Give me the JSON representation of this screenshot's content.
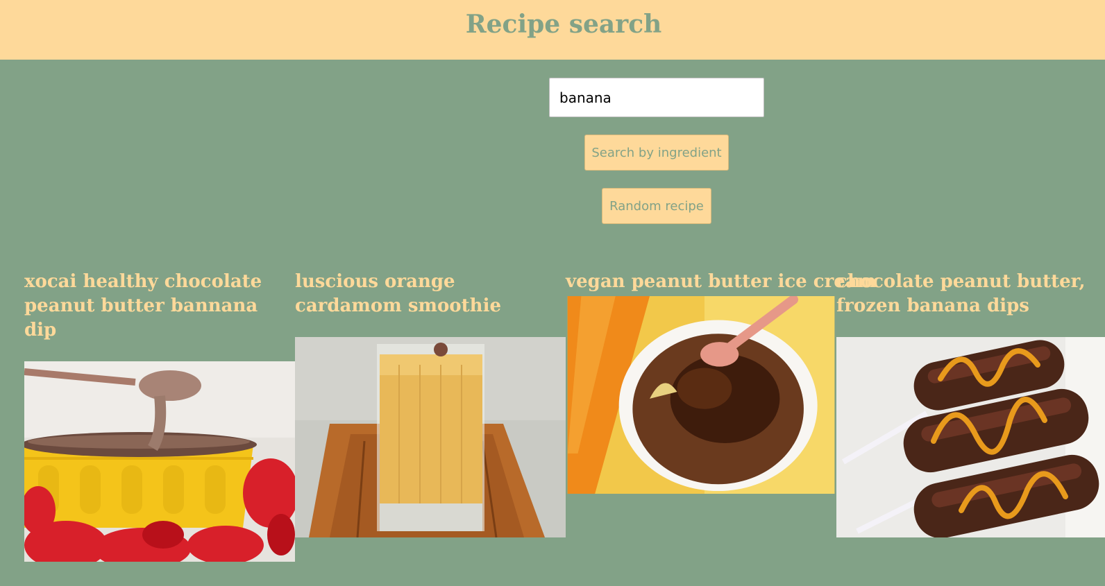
{
  "header": {
    "title": "Recipe search"
  },
  "search": {
    "value": "banana"
  },
  "buttons": {
    "ingredient": "Search by ingredient",
    "random": "Random recipe"
  },
  "recipes": [
    {
      "title": "xocai healthy chocolate peanut butter bannana dip"
    },
    {
      "title": "luscious orange cardamom smoothie"
    },
    {
      "title": "vegan peanut butter ice cream"
    },
    {
      "title": "chocolate peanut butter, frozen banana dips"
    }
  ],
  "colors": {
    "background": "#82a287",
    "header": "#fed99a",
    "accent_text": "#fed99a"
  }
}
